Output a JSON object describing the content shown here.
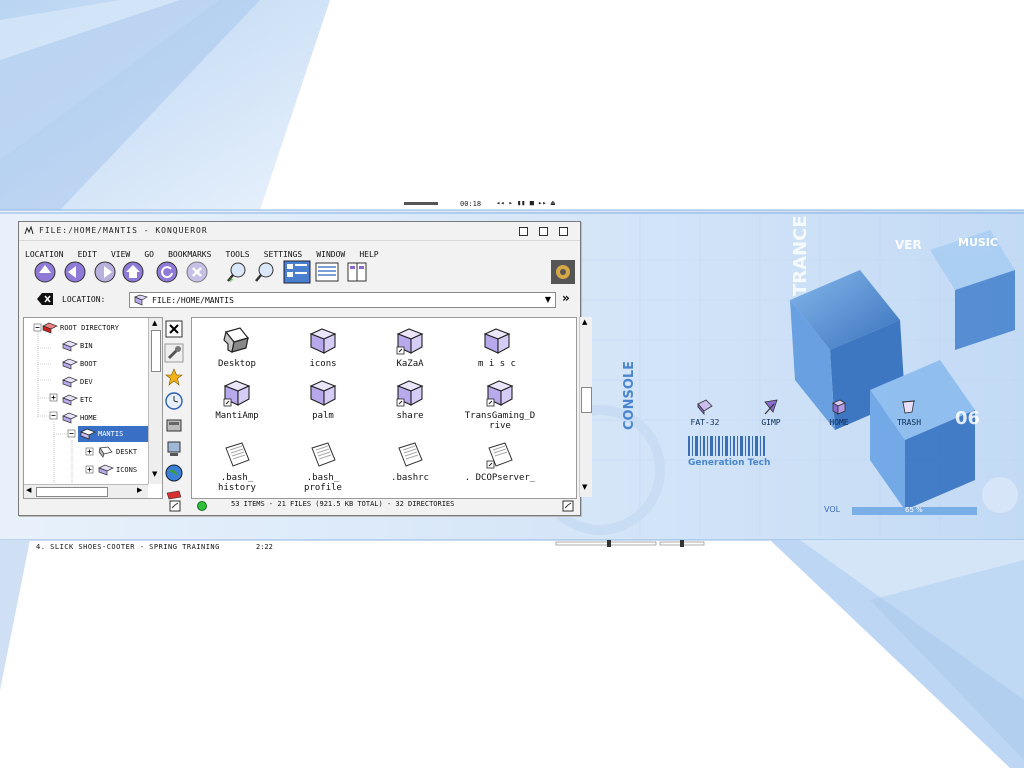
{
  "window": {
    "title": "FILE:/HOME/MANTIS - KONQUEROR",
    "menu": [
      "LOCATION",
      "EDIT",
      "VIEW",
      "GO",
      "BOOKMARKS",
      "TOOLS",
      "SETTINGS",
      "WINDOW",
      "HELP"
    ],
    "location_label": "LOCATION:",
    "location_value": "FILE:/HOME/MANTIS",
    "status": "53 ITEMS - 21 FILES (921.5 KB TOTAL) - 32 DIRECTORIES"
  },
  "tree": {
    "items": [
      "ROOT DIRECTORY",
      "BIN",
      "BOOT",
      "DEV",
      "ETC",
      "HOME",
      "MANTIS",
      "DESKT",
      "ICONS"
    ]
  },
  "files": [
    {
      "name": "Desktop",
      "icon": "desktop-folder-icon"
    },
    {
      "name": "icons",
      "icon": "folder-icon"
    },
    {
      "name": "KaZaA",
      "icon": "folder-link-icon"
    },
    {
      "name": "m i s c",
      "icon": "folder-icon"
    },
    {
      "name": "MantiAmp",
      "icon": "folder-link-icon"
    },
    {
      "name": "palm",
      "icon": "folder-icon"
    },
    {
      "name": "share",
      "icon": "folder-link-icon"
    },
    {
      "name": "TransGaming_Drive",
      "icon": "folder-link-icon"
    },
    {
      "name": ".bash_ history",
      "icon": "text-file-icon"
    },
    {
      "name": ".bash_ profile",
      "icon": "text-file-icon"
    },
    {
      "name": ".bashrc",
      "icon": "text-file-icon"
    },
    {
      "name": ". DCOPserver_",
      "icon": "text-file-icon"
    }
  ],
  "desktop": {
    "icons": [
      {
        "label": "FAT-32",
        "icon": "drive-icon"
      },
      {
        "label": "GIMP",
        "icon": "gimp-icon"
      },
      {
        "label": "HOME",
        "icon": "home-icon"
      },
      {
        "label": "TRASH",
        "icon": "trash-icon"
      }
    ],
    "now_playing": "4. SLICK SHOES-COOTER - SPRING TRAINING",
    "track_time": "2:22",
    "player_time": "00:18",
    "vol_label": "VOL",
    "vol_value": "65 %",
    "wallpaper_words": [
      "TRANCE",
      "CONSOLE",
      "Generation Tech",
      "VER",
      "MUSIC",
      "06"
    ]
  },
  "colors": {
    "accent": "#3a7fd0",
    "light": "#cfe2f8",
    "dark": "#0d2c56"
  }
}
